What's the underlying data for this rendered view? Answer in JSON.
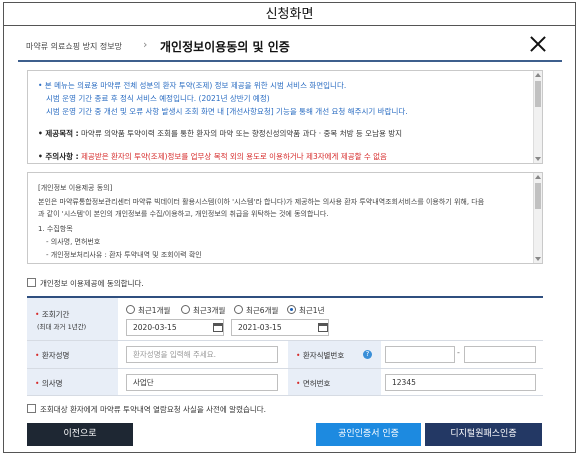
{
  "caption": "신청화면",
  "header": {
    "breadcrumb": "마약류 의료쇼핑 방지 정보망",
    "separator": "›",
    "title": "개인정보이용동의 및 인증"
  },
  "notice": {
    "line1": "• 본 메뉴는 의료용 마약류 전체 성분의 환자 투약(조제) 정보 제공을 위한 시범 서비스 화면입니다.",
    "line2": "시범 운영 기간 종료 후 정식 서비스 예정입니다. (2021년 상반기 예정)",
    "line3": "시범 운영 기간 중 개선 및 오류 사항 발생시 조회 화면 내 [개선사항요청] 기능을 통해 개선 요청 해주시기 바랍니다.",
    "purpose_label": "• 제공목적 :",
    "purpose_text": "마약류 의약품 투약이력 조회를 통한 환자의 마약 또는 향정신성의약품 과다 · 중복 처방 등 오남용 방지",
    "caution_label": "• 주의사항 :",
    "caution_text": "제공받은 환자의 투약(조제)정보를 업무상 목적 외의 용도로 이용하거나 제3자에게 제공할 수 없음"
  },
  "terms": {
    "heading": "[개인정보 이용제공 동의]",
    "line1": "본인은 마약류통합정보관리센터 마약류 빅데이터 활용시스템(이하 '시스템'라 합니다)가 제공하는 의사용 환자 투약내역조회서비스를 이용하기 위해, 다음",
    "line2": "과 같이 '시스템'이 본인의 개인정보를 수집/이용하고, 개인정보의 취급을 위탁하는 것에 동의합니다.",
    "item1": "1. 수집항목",
    "item1a": "- 의사명, 면허번호",
    "item1b": "- 개인정보처리사유 : 환자 투약내역 및 조회이력 확인"
  },
  "consent_label": "개인정보 이용제공에 동의합니다.",
  "form": {
    "period_label": "조회기간",
    "period_sub": "(최대 과거 1년간)",
    "radios": [
      "최근1개월",
      "최근3개월",
      "최근6개월",
      "최근1년"
    ],
    "selected_radio": "최근1년",
    "date_from": "2020-03-15",
    "date_to": "2021-03-15",
    "patient_name_label": "환자성명",
    "patient_name_placeholder": "환자성명을 입력해 주세요.",
    "patient_id_label": "환자식별번호",
    "patient_id_sep": "-",
    "doctor_label": "의사명",
    "doctor_value": "사업단",
    "license_label": "면허번호",
    "license_value": "12345",
    "required_mark": "•",
    "help_glyph": "?"
  },
  "notify_label": "조회대상 환자에게 마약류 투약내역 열람요청 사실을 사전에 알렸습니다.",
  "buttons": {
    "prev": "이전으로",
    "cert": "공인인증서 인증",
    "digital": "디지털원패스인증"
  },
  "colors": {
    "notice_blue": "#2a6cc2",
    "warning_red": "#d62b2b",
    "form_label_bg": "#e8eef7",
    "cert_button": "#1d8ae0",
    "digital_button": "#233864",
    "prev_button": "#1e2733"
  },
  "icons": [
    "close-icon",
    "calendar-icon",
    "help-icon",
    "checkbox-icon",
    "radio-icon"
  ]
}
